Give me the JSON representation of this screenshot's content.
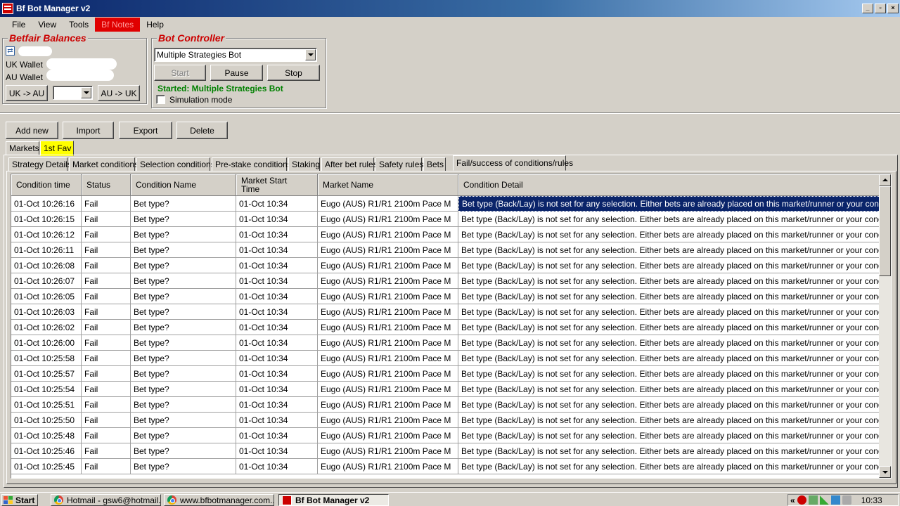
{
  "window": {
    "title": "Bf Bot Manager v2"
  },
  "menu": [
    "File",
    "View",
    "Tools",
    "Bf Notes",
    "Help"
  ],
  "balances": {
    "title": "Betfair Balances",
    "uk_label": "UK Wallet",
    "au_label": "AU Wallet",
    "uk_to_au": "UK -> AU",
    "au_to_uk": "AU -> UK"
  },
  "controller": {
    "title": "Bot Controller",
    "selected_bot": "Multiple Strategies Bot",
    "start": "Start",
    "pause": "Pause",
    "stop": "Stop",
    "status": "Started: Multiple Strategies Bot",
    "simulation": "Simulation mode"
  },
  "toolbar": {
    "add": "Add new",
    "import": "Import",
    "export": "Export",
    "delete": "Delete"
  },
  "outer_tabs": [
    "Markets",
    "1st Fav"
  ],
  "inner_tabs": [
    "Strategy Details",
    "Market conditions",
    "Selection conditions",
    "Pre-stake conditions",
    "Staking",
    "After bet rules",
    "Safety rules",
    "Bets",
    "Fail/success of conditions/rules"
  ],
  "grid": {
    "columns": [
      "Condition time",
      "Status",
      "Condition Name",
      "Market Start Time",
      "Market Name",
      "Condition Detail"
    ],
    "rows": [
      [
        "01-Oct 10:26:16",
        "Fail",
        "Bet type?",
        "01-Oct 10:34",
        "Eugo (AUS)  R1/R1 2100m Pace M",
        "Bet type (Back/Lay) is not set for any selection. Either bets are already placed on this market/runner or your conditions/rule..."
      ],
      [
        "01-Oct 10:26:15",
        "Fail",
        "Bet type?",
        "01-Oct 10:34",
        "Eugo (AUS)  R1/R1 2100m Pace M",
        "Bet type (Back/Lay) is not set for any selection. Either bets are already placed on this market/runner or your conditions/rule..."
      ],
      [
        "01-Oct 10:26:12",
        "Fail",
        "Bet type?",
        "01-Oct 10:34",
        "Eugo (AUS)  R1/R1 2100m Pace M",
        "Bet type (Back/Lay) is not set for any selection. Either bets are already placed on this market/runner or your conditions/rule..."
      ],
      [
        "01-Oct 10:26:11",
        "Fail",
        "Bet type?",
        "01-Oct 10:34",
        "Eugo (AUS)  R1/R1 2100m Pace M",
        "Bet type (Back/Lay) is not set for any selection. Either bets are already placed on this market/runner or your conditions/rule..."
      ],
      [
        "01-Oct 10:26:08",
        "Fail",
        "Bet type?",
        "01-Oct 10:34",
        "Eugo (AUS)  R1/R1 2100m Pace M",
        "Bet type (Back/Lay) is not set for any selection. Either bets are already placed on this market/runner or your conditions/rule..."
      ],
      [
        "01-Oct 10:26:07",
        "Fail",
        "Bet type?",
        "01-Oct 10:34",
        "Eugo (AUS)  R1/R1 2100m Pace M",
        "Bet type (Back/Lay) is not set for any selection. Either bets are already placed on this market/runner or your conditions/rule..."
      ],
      [
        "01-Oct 10:26:05",
        "Fail",
        "Bet type?",
        "01-Oct 10:34",
        "Eugo (AUS)  R1/R1 2100m Pace M",
        "Bet type (Back/Lay) is not set for any selection. Either bets are already placed on this market/runner or your conditions/rule..."
      ],
      [
        "01-Oct 10:26:03",
        "Fail",
        "Bet type?",
        "01-Oct 10:34",
        "Eugo (AUS)  R1/R1 2100m Pace M",
        "Bet type (Back/Lay) is not set for any selection. Either bets are already placed on this market/runner or your conditions/rule..."
      ],
      [
        "01-Oct 10:26:02",
        "Fail",
        "Bet type?",
        "01-Oct 10:34",
        "Eugo (AUS)  R1/R1 2100m Pace M",
        "Bet type (Back/Lay) is not set for any selection. Either bets are already placed on this market/runner or your conditions/rule..."
      ],
      [
        "01-Oct 10:26:00",
        "Fail",
        "Bet type?",
        "01-Oct 10:34",
        "Eugo (AUS)  R1/R1 2100m Pace M",
        "Bet type (Back/Lay) is not set for any selection. Either bets are already placed on this market/runner or your conditions/rule..."
      ],
      [
        "01-Oct 10:25:58",
        "Fail",
        "Bet type?",
        "01-Oct 10:34",
        "Eugo (AUS)  R1/R1 2100m Pace M",
        "Bet type (Back/Lay) is not set for any selection. Either bets are already placed on this market/runner or your conditions/rule..."
      ],
      [
        "01-Oct 10:25:57",
        "Fail",
        "Bet type?",
        "01-Oct 10:34",
        "Eugo (AUS)  R1/R1 2100m Pace M",
        "Bet type (Back/Lay) is not set for any selection. Either bets are already placed on this market/runner or your conditions/rule..."
      ],
      [
        "01-Oct 10:25:54",
        "Fail",
        "Bet type?",
        "01-Oct 10:34",
        "Eugo (AUS)  R1/R1 2100m Pace M",
        "Bet type (Back/Lay) is not set for any selection. Either bets are already placed on this market/runner or your conditions/rule..."
      ],
      [
        "01-Oct 10:25:51",
        "Fail",
        "Bet type?",
        "01-Oct 10:34",
        "Eugo (AUS)  R1/R1 2100m Pace M",
        "Bet type (Back/Lay) is not set for any selection. Either bets are already placed on this market/runner or your conditions/rule..."
      ],
      [
        "01-Oct 10:25:50",
        "Fail",
        "Bet type?",
        "01-Oct 10:34",
        "Eugo (AUS)  R1/R1 2100m Pace M",
        "Bet type (Back/Lay) is not set for any selection. Either bets are already placed on this market/runner or your conditions/rule..."
      ],
      [
        "01-Oct 10:25:48",
        "Fail",
        "Bet type?",
        "01-Oct 10:34",
        "Eugo (AUS)  R1/R1 2100m Pace M",
        "Bet type (Back/Lay) is not set for any selection. Either bets are already placed on this market/runner or your conditions/rule..."
      ],
      [
        "01-Oct 10:25:46",
        "Fail",
        "Bet type?",
        "01-Oct 10:34",
        "Eugo (AUS)  R1/R1 2100m Pace M",
        "Bet type (Back/Lay) is not set for any selection. Either bets are already placed on this market/runner or your conditions/rule..."
      ],
      [
        "01-Oct 10:25:45",
        "Fail",
        "Bet type?",
        "01-Oct 10:34",
        "Eugo (AUS)  R1/R1 2100m Pace M",
        "Bet type (Back/Lay) is not set for any selection. Either bets are already placed on this market/runner or your conditions/rule..."
      ]
    ]
  },
  "taskbar": {
    "start": "Start",
    "tasks": [
      "Hotmail - gsw6@hotmail....",
      "www.bfbotmanager.com...",
      "Bf Bot Manager v2"
    ],
    "clock": "10:33"
  }
}
